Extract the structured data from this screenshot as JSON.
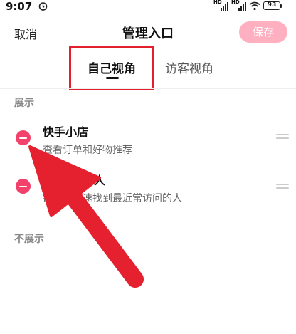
{
  "status_bar": {
    "time": "9:07",
    "hd_label": "HD",
    "battery": "93"
  },
  "header": {
    "cancel_label": "取消",
    "title": "管理入口",
    "save_label": "保存"
  },
  "tabs": [
    {
      "label": "自己视角",
      "active": true
    },
    {
      "label": "访客视角",
      "active": false
    }
  ],
  "sections": {
    "shown_label": "展示",
    "hidden_label": "不展示"
  },
  "items": [
    {
      "title": "快手小店",
      "desc": "查看订单和好物推荐"
    },
    {
      "title": "问的人",
      "desc": "帮助你快速找到最近常访问的人"
    }
  ],
  "colors": {
    "accent": "#f2416b",
    "save_disabled": "#ffb0c0",
    "highlight_box": "#e21f2b",
    "arrow": "#e5202f"
  }
}
